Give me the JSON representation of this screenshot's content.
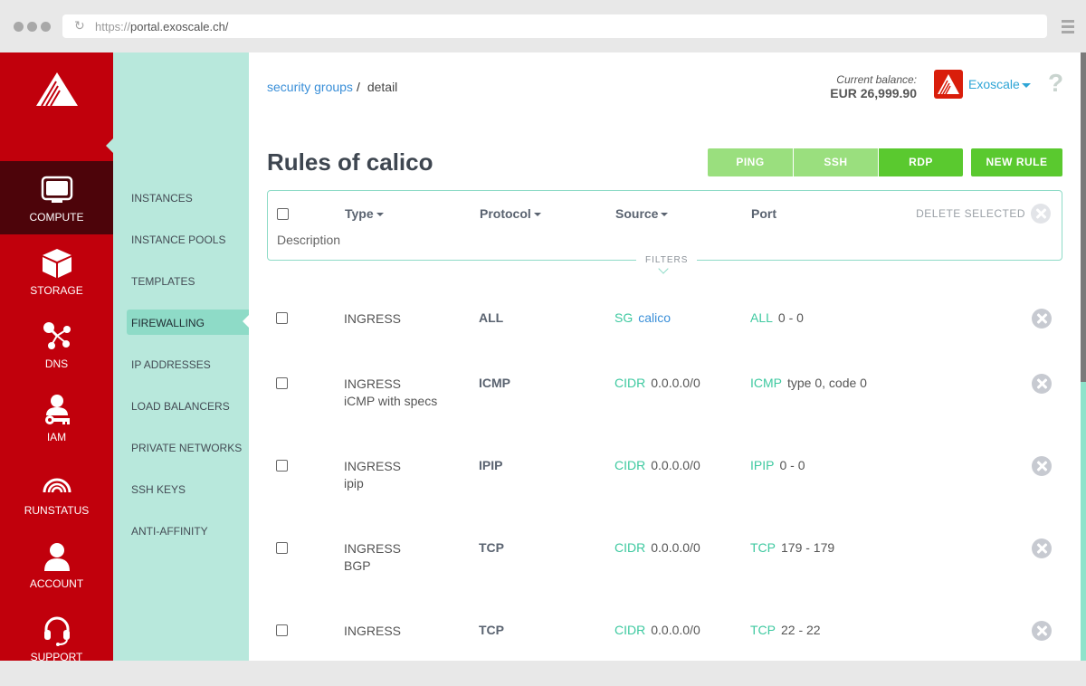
{
  "browser": {
    "url_protocol": "https://",
    "url_host": "portal.exoscale.ch/"
  },
  "primary_nav": {
    "items": [
      {
        "label": "COMPUTE",
        "icon": "monitor-icon",
        "active": true
      },
      {
        "label": "STORAGE",
        "icon": "box-icon",
        "active": false
      },
      {
        "label": "DNS",
        "icon": "share-nodes-icon",
        "active": false
      },
      {
        "label": "IAM",
        "icon": "user-key-icon",
        "active": false
      },
      {
        "label": "RUNSTATUS",
        "icon": "signal-arc-icon",
        "active": false
      },
      {
        "label": "ACCOUNT",
        "icon": "user-icon",
        "active": false
      },
      {
        "label": "SUPPORT",
        "icon": "headset-icon",
        "active": false
      }
    ]
  },
  "secondary_nav": {
    "items": [
      {
        "label": "INSTANCES",
        "active": false
      },
      {
        "label": "INSTANCE POOLS",
        "active": false
      },
      {
        "label": "TEMPLATES",
        "active": false
      },
      {
        "label": "FIREWALLING",
        "active": true
      },
      {
        "label": "IP ADDRESSES",
        "active": false
      },
      {
        "label": "LOAD BALANCERS",
        "active": false
      },
      {
        "label": "PRIVATE NETWORKS",
        "active": false
      },
      {
        "label": "SSH KEYS",
        "active": false
      },
      {
        "label": "ANTI-AFFINITY",
        "active": false
      }
    ]
  },
  "header": {
    "breadcrumb": [
      {
        "label": "security groups",
        "link": true
      },
      {
        "label": "detail",
        "link": false
      }
    ],
    "breadcrumb_separator": "/",
    "balance_caption": "Current balance:",
    "balance_value": "EUR 26,999.90",
    "org_name": "Exoscale",
    "help_label": "?"
  },
  "page": {
    "title": "Rules of calico",
    "quick_buttons": [
      {
        "label": "PING"
      },
      {
        "label": "SSH"
      },
      {
        "label": "RDP"
      }
    ],
    "new_rule_label": "NEW RULE"
  },
  "filters": {
    "columns": [
      "Type",
      "Protocol",
      "Source",
      "Port"
    ],
    "description_label": "Description",
    "delete_selected_label": "DELETE SELECTED",
    "filters_label": "FILTERS"
  },
  "rules": [
    {
      "type": "INGRESS",
      "description": "",
      "protocol": "ALL",
      "source_kind": "SG",
      "source_value": "calico",
      "source_is_link": true,
      "port_kind": "ALL",
      "port_value": "0 - 0"
    },
    {
      "type": "INGRESS",
      "description": "iCMP with specs",
      "protocol": "ICMP",
      "source_kind": "CIDR",
      "source_value": "0.0.0.0/0",
      "source_is_link": false,
      "port_kind": "ICMP",
      "port_value": "type 0, code 0"
    },
    {
      "type": "INGRESS",
      "description": "ipip",
      "protocol": "IPIP",
      "source_kind": "CIDR",
      "source_value": "0.0.0.0/0",
      "source_is_link": false,
      "port_kind": "IPIP",
      "port_value": "0 - 0"
    },
    {
      "type": "INGRESS",
      "description": "BGP",
      "protocol": "TCP",
      "source_kind": "CIDR",
      "source_value": "0.0.0.0/0",
      "source_is_link": false,
      "port_kind": "TCP",
      "port_value": "179 - 179"
    },
    {
      "type": "INGRESS",
      "description": "",
      "protocol": "TCP",
      "source_kind": "CIDR",
      "source_value": "0.0.0.0/0",
      "source_is_link": false,
      "port_kind": "TCP",
      "port_value": "22 - 22"
    }
  ]
}
